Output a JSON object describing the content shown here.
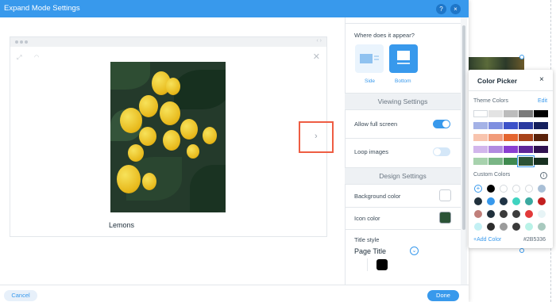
{
  "window": {
    "title": "Expand Mode Settings",
    "help_icon": "?",
    "close_icon": "×"
  },
  "preview": {
    "photo_title": "Lemons",
    "close_icon": "✕",
    "next_arrow": "›",
    "browser_arrows": "‹ ›"
  },
  "panel": {
    "appear_label": "Where does it appear?",
    "layout_options": [
      {
        "label": "Side",
        "selected": false
      },
      {
        "label": "Bottom",
        "selected": true
      }
    ],
    "viewing_title": "Viewing Settings",
    "allow_fullscreen_label": "Allow full screen",
    "allow_fullscreen_on": true,
    "loop_images_label": "Loop images",
    "loop_images_on": false,
    "design_title": "Design Settings",
    "background_color_label": "Background color",
    "background_color": "#FFFFFF",
    "icon_color_label": "Icon color",
    "icon_color": "#2B5336",
    "title_style_label": "Title style",
    "title_style_value": "Page Title",
    "title_color": "#000000"
  },
  "footer": {
    "cancel_label": "Cancel",
    "done_label": "Done"
  },
  "color_picker": {
    "title": "Color Picker",
    "close_icon": "×",
    "theme_label": "Theme Colors",
    "edit_label": "Edit",
    "theme_rows": [
      [
        "#ffffff",
        "#e3e3e3",
        "#bcbcbc",
        "#7a7a7a",
        "#000000"
      ],
      [
        "#a4b2e6",
        "#7f8fe0",
        "#3d52c9",
        "#2a3aa0",
        "#141e5c"
      ],
      [
        "#f8c4ae",
        "#f19b7a",
        "#e4652f",
        "#a8431a",
        "#5a220b"
      ],
      [
        "#d2b6ec",
        "#b18ae0",
        "#8a3fd1",
        "#5e2699",
        "#2f1150"
      ],
      [
        "#a7d2ad",
        "#79b585",
        "#3f8a4f",
        "#2b5336",
        "#173020"
      ]
    ],
    "custom_label": "Custom Colors",
    "info_icon": "i",
    "add_symbol": "+",
    "custom_colors": [
      "#000000",
      "#ffffff",
      "#ffffff",
      "#ffffff",
      "#a9bfd6",
      "#20303c",
      "#3899ec",
      "#1f3345",
      "#3fd3c0",
      "#3aa9a0",
      "#c21f1f",
      "#c07f7a",
      "#20303c",
      "#3a3a3a",
      "#3c3c3c",
      "#e23a3a",
      "#e7f4f6",
      "#c3f0f4",
      "#2c2c2c",
      "#9b9b9b",
      "#3a3a3a",
      "#b9f2e7",
      "#a8c9be",
      "#7bb0a8"
    ],
    "add_color_label": "+Add Color",
    "hex_value": "#2B5336"
  },
  "colors": {
    "accent": "#3899ec",
    "highlight": "#ee5d43"
  }
}
